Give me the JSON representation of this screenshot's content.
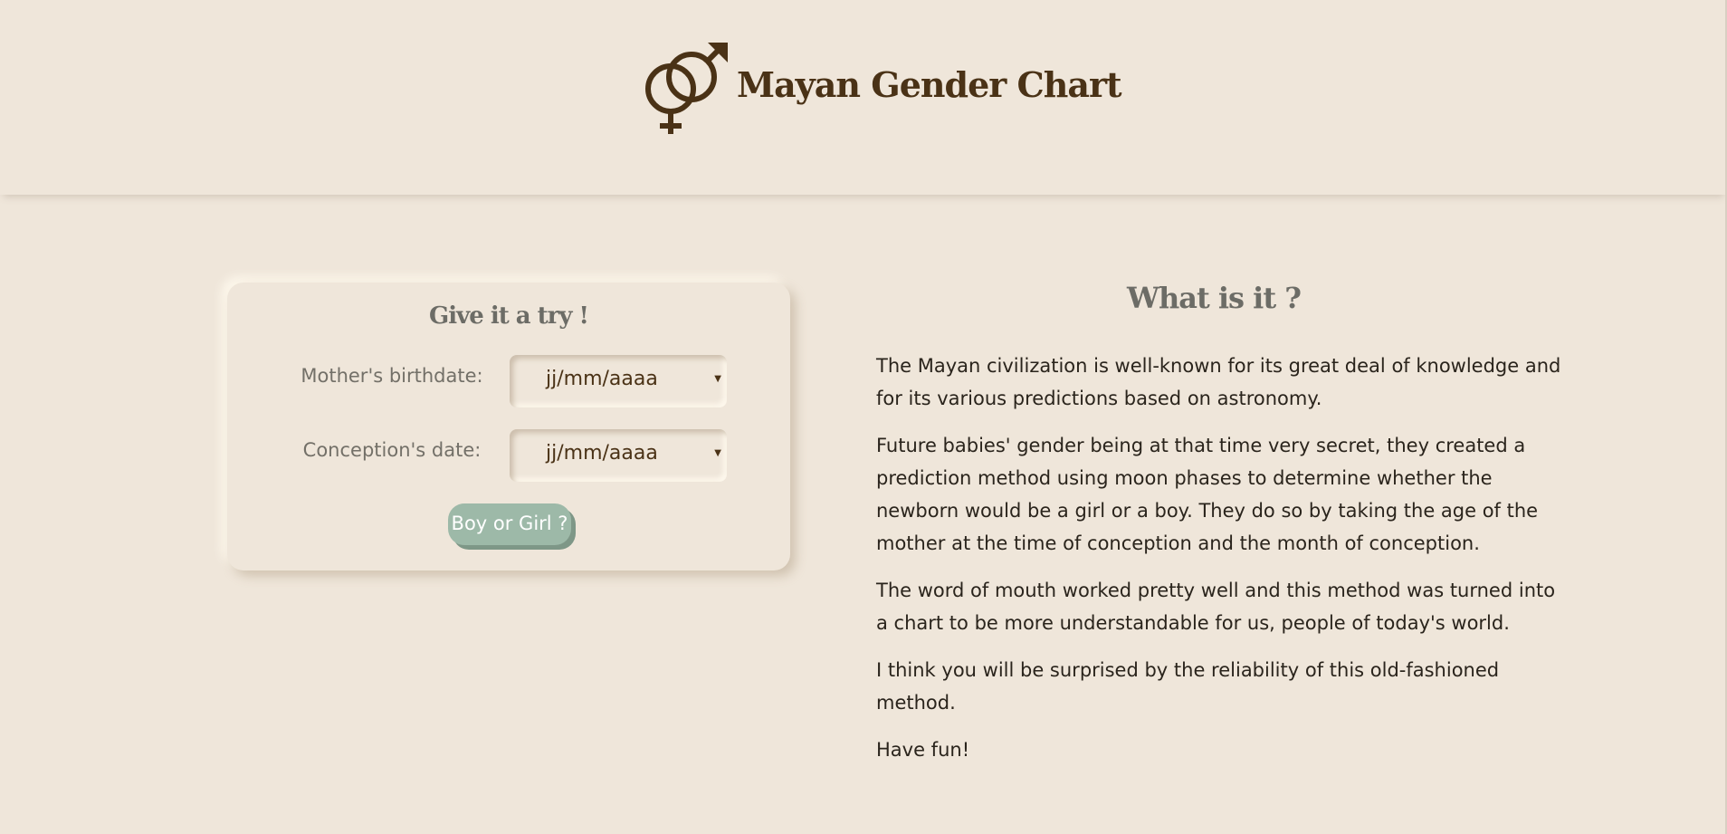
{
  "header": {
    "icon": "male-female-symbol-icon",
    "title": "Mayan Gender Chart"
  },
  "form": {
    "title": "Give it a try !",
    "mother_birthdate_label": "Mother's birthdate:",
    "mother_birthdate_value": "jj/mm/aaaa",
    "conception_date_label": "Conception's date:",
    "conception_date_value": "jj/mm/aaaa",
    "submit_label": "Boy or Girl ?"
  },
  "info": {
    "title": "What is it ?",
    "paragraphs": [
      "The Mayan civilization is well-known for its great deal of knowledge and for its various predictions based on astronomy.",
      "Future babies' gender being at that time very secret, they created a prediction method using moon phases to determine whether the newborn would be a girl or a boy. They do so by taking the age of the mother at the time of conception and the month of conception.",
      "The word of mouth worked pretty well and this method was turned into a chart to be more understandable for us, people of today's world.",
      "I think you will be surprised by the reliability of this old-fashioned method.",
      "Have fun!"
    ]
  },
  "colors": {
    "background": "#efe6da",
    "brand_brown": "#4a3216",
    "heading_gray": "#6c6c66",
    "button_green": "#9db9a8"
  }
}
